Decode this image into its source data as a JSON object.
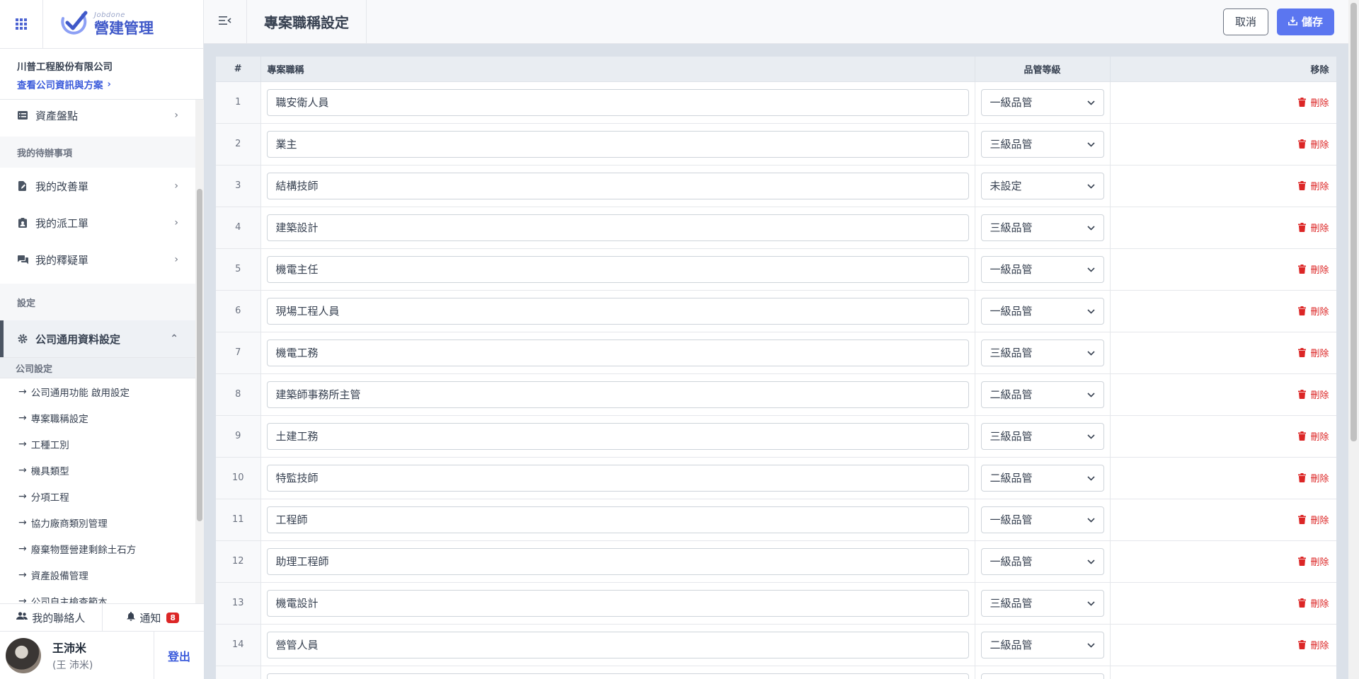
{
  "brand": {
    "sub": "Jobdone",
    "main": "營建管理"
  },
  "company": {
    "name": "川普工程股份有限公司",
    "link": "查看公司資訊與方案"
  },
  "nav": {
    "asset_check": "資產盤點",
    "todo_section": "我的待辦事項",
    "improvement": "我的改善單",
    "dispatch": "我的派工單",
    "clarification": "我的釋疑單",
    "settings_section": "設定",
    "company_common": "公司通用資料設定",
    "company_settings": "公司設定",
    "sub_items": [
      "公司通用功能 啟用設定",
      "專案職稱設定",
      "工種工別",
      "機具類型",
      "分項工程",
      "協力廠商類別管理",
      "廢棄物暨營建剩餘土石方",
      "資產設備管理",
      "公司自主檢查範本"
    ]
  },
  "bottom": {
    "contacts": "我的聯絡人",
    "notify": "通知",
    "notify_count": "8"
  },
  "user": {
    "name": "王沛米",
    "alias": "(王 沛米)",
    "logout": "登出"
  },
  "header": {
    "title": "專案職稱設定",
    "cancel": "取消",
    "save": "儲存"
  },
  "table": {
    "columns": {
      "num": "#",
      "title": "專案職稱",
      "grade": "品管等級",
      "remove": "移除"
    },
    "delete_label": "刪除",
    "rows": [
      {
        "num": "1",
        "title": "職安衛人員",
        "grade": "一級品管"
      },
      {
        "num": "2",
        "title": "業主",
        "grade": "三級品管"
      },
      {
        "num": "3",
        "title": "結構技師",
        "grade": "未設定"
      },
      {
        "num": "4",
        "title": "建築設計",
        "grade": "三級品管"
      },
      {
        "num": "5",
        "title": "機電主任",
        "grade": "一級品管"
      },
      {
        "num": "6",
        "title": "現場工程人員",
        "grade": "一級品管"
      },
      {
        "num": "7",
        "title": "機電工務",
        "grade": "三級品管"
      },
      {
        "num": "8",
        "title": "建築師事務所主管",
        "grade": "二級品管"
      },
      {
        "num": "9",
        "title": "土建工務",
        "grade": "三級品管"
      },
      {
        "num": "10",
        "title": "特監技師",
        "grade": "二級品管"
      },
      {
        "num": "11",
        "title": "工程師",
        "grade": "一級品管"
      },
      {
        "num": "12",
        "title": "助理工程師",
        "grade": "一級品管"
      },
      {
        "num": "13",
        "title": "機電設計",
        "grade": "三級品管"
      },
      {
        "num": "14",
        "title": "營管人員",
        "grade": "二級品管"
      },
      {
        "num": "",
        "title": "",
        "grade": ""
      }
    ]
  }
}
